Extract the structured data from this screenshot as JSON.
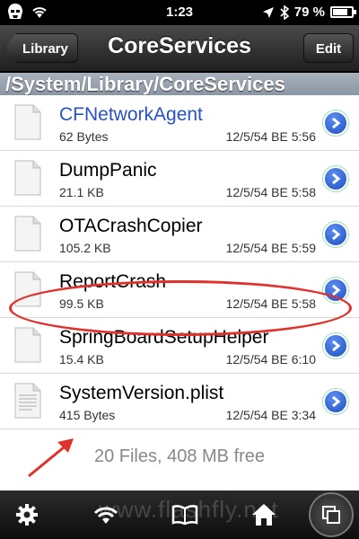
{
  "status": {
    "time": "1:23",
    "battery_text": "79 %",
    "battery_level": 0.79
  },
  "nav": {
    "back_label": "Library",
    "title": "CoreServices",
    "edit_label": "Edit"
  },
  "path": "/System/Library/CoreServices",
  "files": [
    {
      "name": "CFNetworkAgent",
      "size": "62 Bytes",
      "date": "12/5/54 BE 5:56",
      "selected": true
    },
    {
      "name": "DumpPanic",
      "size": "21.1 KB",
      "date": "12/5/54 BE 5:58"
    },
    {
      "name": "OTACrashCopier",
      "size": "105.2 KB",
      "date": "12/5/54 BE 5:59"
    },
    {
      "name": "ReportCrash",
      "size": "99.5 KB",
      "date": "12/5/54 BE 5:58"
    },
    {
      "name": "SpringBoardSetupHelper",
      "size": "15.4 KB",
      "date": "12/5/54 BE 6:10"
    },
    {
      "name": "SystemVersion.plist",
      "size": "415 Bytes",
      "date": "12/5/54 BE 3:34",
      "highlighted": true
    }
  ],
  "footer": "20 Files, 408 MB free",
  "watermark": "www.flashfly.net",
  "colors": {
    "selected_name": "#2850c8",
    "annotation": "#e0312c",
    "disclosure": "#1f4fc2"
  },
  "tabs": [
    "gear-icon",
    "wifi-icon",
    "book-icon",
    "home-icon"
  ]
}
